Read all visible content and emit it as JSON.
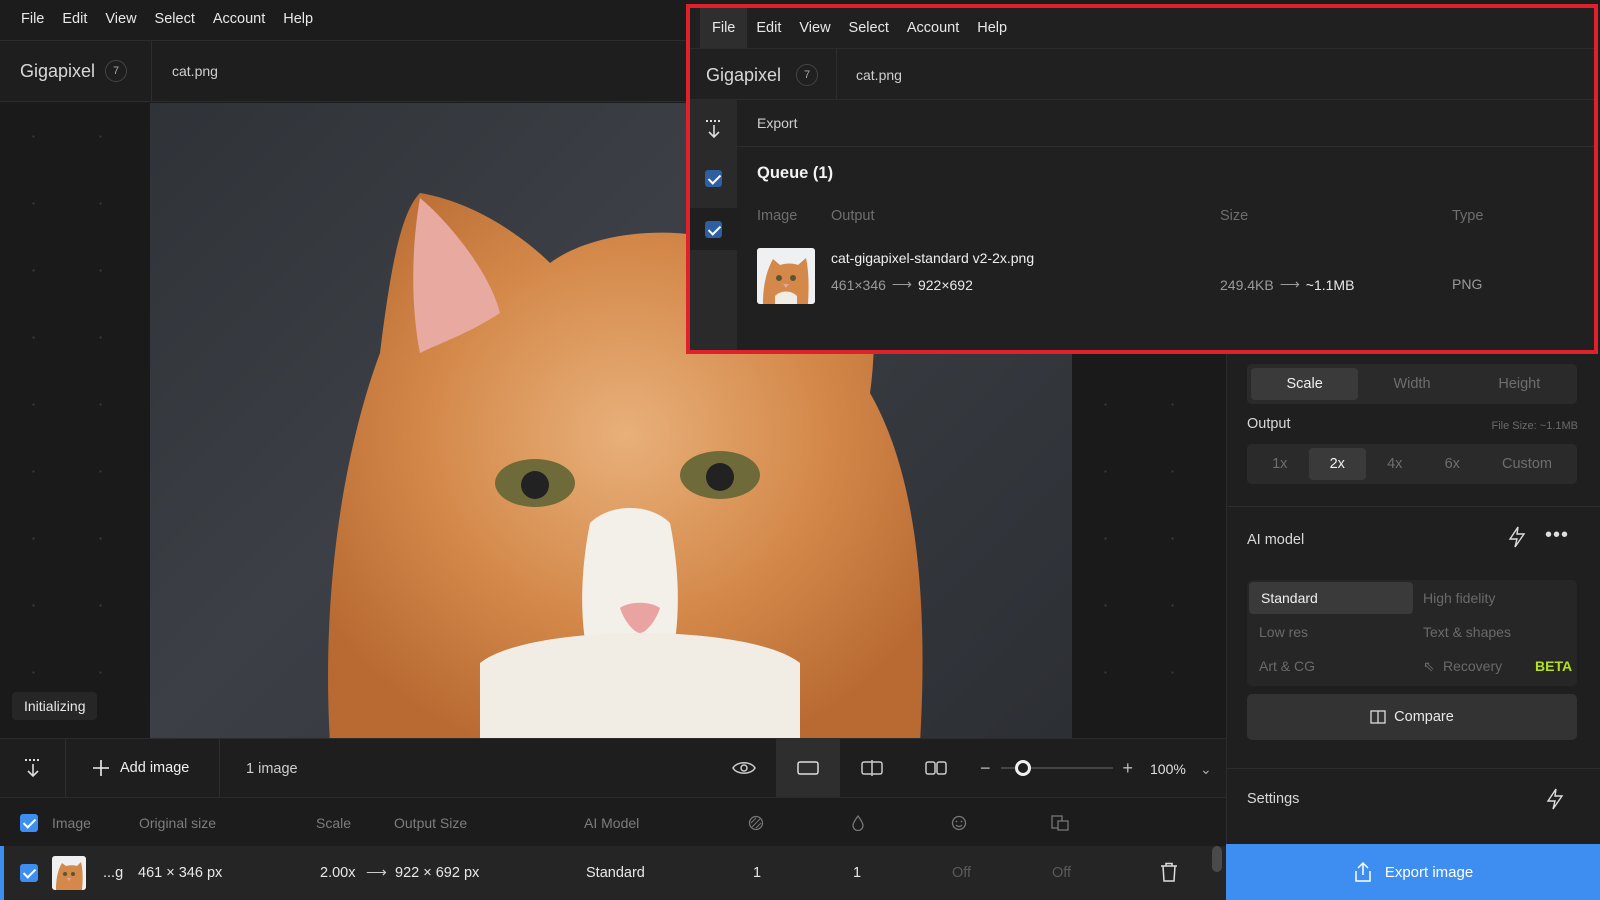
{
  "menu": {
    "file": "File",
    "edit": "Edit",
    "view": "View",
    "select": "Select",
    "account": "Account",
    "help": "Help"
  },
  "app": {
    "name": "Gigapixel",
    "badge_count": "7",
    "file_name": "cat.png"
  },
  "canvas": {
    "status": "Initializing"
  },
  "toolbar": {
    "add_image": "Add image",
    "image_count": "1 image",
    "zoom_value": "100%",
    "zoom_fraction": 0.2
  },
  "table": {
    "headers": {
      "image": "Image",
      "original": "Original size",
      "scale": "Scale",
      "output": "Output Size",
      "model": "AI Model"
    },
    "row": {
      "name": "...g",
      "original": "461 × 346 px",
      "scale": "2.00x",
      "output": "922 × 692 px",
      "model": "Standard",
      "v1": "1",
      "v2": "1",
      "v3": "Off",
      "v4": "Off"
    }
  },
  "panel": {
    "size_tabs": [
      "Scale",
      "Width",
      "Height"
    ],
    "output_label": "Output",
    "file_size_hint": "File Size: ~1.1MB",
    "output_options": [
      "1x",
      "2x",
      "4x",
      "6x",
      "Custom"
    ],
    "ai_model_label": "AI model",
    "models": {
      "standard": "Standard",
      "high_fidelity": "High fidelity",
      "low_res": "Low res",
      "text_shapes": "Text & shapes",
      "art_cg": "Art & CG",
      "recovery": "Recovery",
      "beta": "BETA"
    },
    "compare": "Compare",
    "settings": "Settings",
    "export": "Export image"
  },
  "overlay": {
    "export_label": "Export",
    "queue_title": "Queue (1)",
    "headers": {
      "image": "Image",
      "output": "Output",
      "size": "Size",
      "type": "Type"
    },
    "item": {
      "filename": "cat-gigapixel-standard v2-2x.png",
      "dims_from": "461×346",
      "dims_to": "922×692",
      "size_from": "249.4KB",
      "size_to": "~1.1MB",
      "type": "PNG"
    }
  },
  "colors": {
    "accent": "#3d8ef0",
    "highlight_border": "#e0202a",
    "beta": "#b5e11a"
  }
}
